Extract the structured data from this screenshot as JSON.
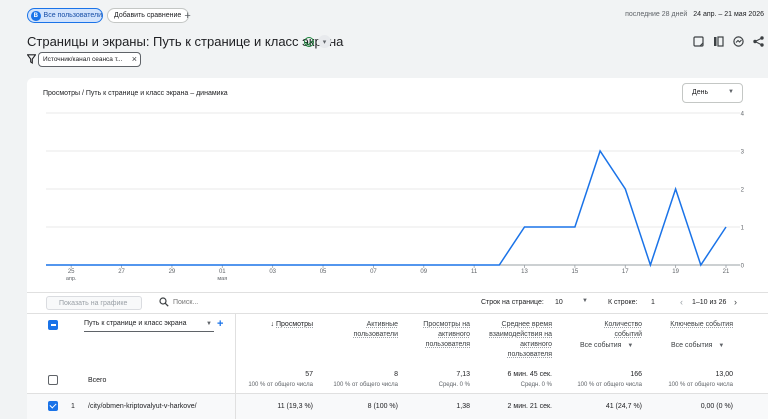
{
  "header": {
    "segment_label": "Все пользователи",
    "segment_letter": "B",
    "add_comparison_label": "Добавить сравнение",
    "date_preset": "последние 28 дней",
    "date_range": "24 апр. – 21 мая 2026"
  },
  "report": {
    "title": "Страницы и экраны: Путь к странице и класс экрана",
    "filter_label": "Источник/канал сеанса т..."
  },
  "chart": {
    "title": "Просмотры / Путь к странице и класс экрана – динамика",
    "granularity": "День"
  },
  "chart_data": {
    "type": "line",
    "title": "Просмотры / Путь к странице и класс экрана – динамика",
    "xlabel": "",
    "ylabel": "",
    "ylim": [
      0,
      4
    ],
    "y_ticks": [
      "4",
      "3",
      "2",
      "1",
      "0"
    ],
    "x_tick_labels": [
      "25",
      "27",
      "29",
      "01",
      "03",
      "05",
      "07",
      "09",
      "11",
      "13",
      "15",
      "17",
      "19",
      "21"
    ],
    "x_tick_sublabels": [
      "апр.",
      "",
      "",
      "мая",
      "",
      "",
      "",
      "",
      "",
      "",
      "",
      "",
      "",
      ""
    ],
    "grid": true,
    "x": [
      "2026-04-24",
      "2026-04-25",
      "2026-04-26",
      "2026-04-27",
      "2026-04-28",
      "2026-04-29",
      "2026-04-30",
      "2026-05-01",
      "2026-05-02",
      "2026-05-03",
      "2026-05-04",
      "2026-05-05",
      "2026-05-06",
      "2026-05-07",
      "2026-05-08",
      "2026-05-09",
      "2026-05-10",
      "2026-05-11",
      "2026-05-12",
      "2026-05-13",
      "2026-05-14",
      "2026-05-15",
      "2026-05-16",
      "2026-05-17",
      "2026-05-18",
      "2026-05-19",
      "2026-05-20",
      "2026-05-21"
    ],
    "series": [
      {
        "values": [
          0,
          0,
          0,
          0,
          0,
          0,
          0,
          0,
          0,
          0,
          0,
          0,
          0,
          0,
          0,
          0,
          0,
          0,
          0,
          1,
          1,
          1,
          3,
          2,
          0,
          2,
          0,
          1
        ]
      }
    ],
    "color": "#1a73e8"
  },
  "table": {
    "plot_button": "Показать на графике",
    "search_placeholder": "Поиск...",
    "rows_per_page_label": "Строк на странице:",
    "rows_per_page": "10",
    "goto_row_label": "К строке:",
    "goto_row": "1",
    "range_label": "1–10 из 26",
    "dimension_label": "Путь к странице и класс экрана",
    "columns": [
      {
        "label": "Просмотры",
        "sorted": true
      },
      {
        "label": "Активные пользователи"
      },
      {
        "label": "Просмотры на активного пользователя"
      },
      {
        "label": "Среднее время взаимодействия на активного пользователя"
      },
      {
        "label": "Количество событий",
        "selector": "Все события"
      },
      {
        "label": "Ключевые события",
        "selector": "Все события"
      }
    ],
    "totals": {
      "label": "Всего",
      "values": [
        "57",
        "8",
        "7,13",
        "6 мин. 45 сек.",
        "166",
        "13,00"
      ],
      "subs": [
        "100 % от общего числа",
        "100 % от общего числа",
        "Средн. 0 %",
        "Средн. 0 %",
        "100 % от общего числа",
        "100 % от общего числа"
      ]
    },
    "rows": [
      {
        "index": "1",
        "path": "/city/obmen-kriptovalyut-v-harkove/",
        "values": [
          "11 (19,3 %)",
          "8 (100 %)",
          "1,38",
          "2 мин. 21 сек.",
          "41 (24,7 %)",
          "0,00 (0 %)"
        ]
      }
    ]
  }
}
